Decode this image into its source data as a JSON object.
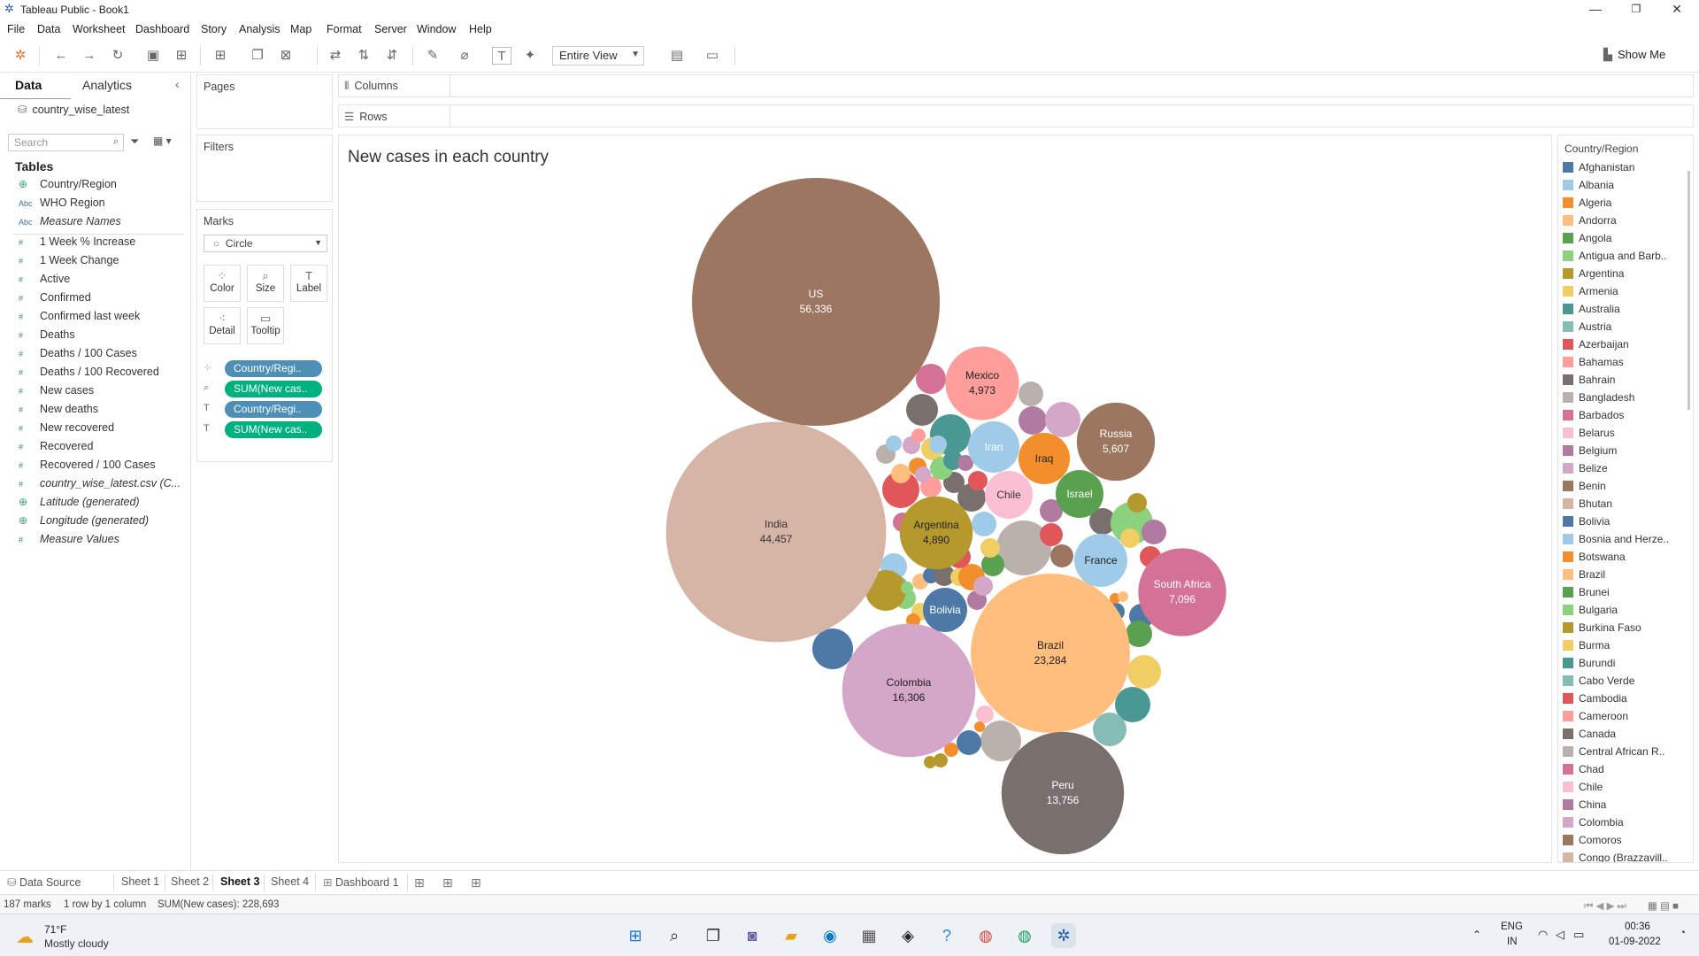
{
  "window": {
    "title": "Tableau Public - Book1",
    "minimize": "—",
    "maximize": "❐",
    "close": "✕"
  },
  "menu": [
    "File",
    "Data",
    "Worksheet",
    "Dashboard",
    "Story",
    "Analysis",
    "Map",
    "Format",
    "Server",
    "Window",
    "Help"
  ],
  "toolbar": {
    "view_mode": "Entire View",
    "show_me": "Show Me"
  },
  "data_pane": {
    "tabs": [
      "Data",
      "Analytics"
    ],
    "datasource": "country_wise_latest",
    "search_placeholder": "Search",
    "tables_header": "Tables",
    "fields": [
      {
        "type": "geo",
        "name": "Country/Region",
        "italic": false
      },
      {
        "type": "abc",
        "name": "WHO Region",
        "italic": false
      },
      {
        "type": "abc",
        "name": "Measure Names",
        "italic": true
      },
      {
        "type": "num",
        "name": "1 Week % Increase",
        "italic": false
      },
      {
        "type": "num",
        "name": "1 Week Change",
        "italic": false
      },
      {
        "type": "num",
        "name": "Active",
        "italic": false
      },
      {
        "type": "num",
        "name": "Confirmed",
        "italic": false
      },
      {
        "type": "num",
        "name": "Confirmed last week",
        "italic": false
      },
      {
        "type": "num",
        "name": "Deaths",
        "italic": false
      },
      {
        "type": "num",
        "name": "Deaths / 100 Cases",
        "italic": false
      },
      {
        "type": "num",
        "name": "Deaths / 100 Recovered",
        "italic": false
      },
      {
        "type": "num",
        "name": "New cases",
        "italic": false
      },
      {
        "type": "num",
        "name": "New deaths",
        "italic": false
      },
      {
        "type": "num",
        "name": "New recovered",
        "italic": false
      },
      {
        "type": "num",
        "name": "Recovered",
        "italic": false
      },
      {
        "type": "num",
        "name": "Recovered / 100 Cases",
        "italic": false
      },
      {
        "type": "num",
        "name": "country_wise_latest.csv (C...",
        "italic": true
      },
      {
        "type": "geo",
        "name": "Latitude (generated)",
        "italic": true
      },
      {
        "type": "geo",
        "name": "Longitude (generated)",
        "italic": true
      },
      {
        "type": "num",
        "name": "Measure Values",
        "italic": true
      }
    ]
  },
  "shelves": {
    "pages": "Pages",
    "filters": "Filters",
    "marks": "Marks",
    "marks_type": "Circle",
    "mark_buttons": [
      "Color",
      "Size",
      "Label",
      "Detail",
      "Tooltip"
    ],
    "pills": [
      {
        "kind": "dim",
        "icon": "color-icon",
        "label": "Country/Regi.."
      },
      {
        "kind": "mea",
        "icon": "size-icon",
        "label": "SUM(New cas.."
      },
      {
        "kind": "dim",
        "icon": "label-icon",
        "label": "Country/Regi.."
      },
      {
        "kind": "mea",
        "icon": "label-icon",
        "label": "SUM(New cas.."
      }
    ],
    "columns": "Columns",
    "rows": "Rows"
  },
  "viz": {
    "title": "New cases in each country"
  },
  "chart_data": {
    "type": "bubble",
    "title": "New cases in each country",
    "measure": "SUM(New cases)",
    "labeled": [
      {
        "name": "US",
        "value": 56336,
        "color": "#9c7661"
      },
      {
        "name": "India",
        "value": 44457,
        "color": "#d7b5a6"
      },
      {
        "name": "Brazil",
        "value": 23284,
        "color": "#ffbe7d"
      },
      {
        "name": "Colombia",
        "value": 16306,
        "color": "#d4a6c8"
      },
      {
        "name": "Peru",
        "value": 13756,
        "color": "#79706e"
      },
      {
        "name": "South Africa",
        "value": 7096,
        "color": "#d37295"
      },
      {
        "name": "Russia",
        "value": 5607,
        "color": "#9d7660"
      },
      {
        "name": "Mexico",
        "value": 4973,
        "color": "#ff9d9a"
      },
      {
        "name": "Argentina",
        "value": 4890,
        "color": "#b6992d"
      },
      {
        "name": "Iran",
        "value": null,
        "color": "#a0cbe8"
      },
      {
        "name": "Iraq",
        "value": null,
        "color": "#f28e2b"
      },
      {
        "name": "Chile",
        "value": null,
        "color": "#fabfd2"
      },
      {
        "name": "Israel",
        "value": null,
        "color": "#59a14f"
      },
      {
        "name": "France",
        "value": null,
        "color": "#a0cbe8"
      },
      {
        "name": "Bolivia",
        "value": null,
        "color": "#4e79a7"
      }
    ]
  },
  "legend": {
    "title": "Country/Region",
    "items": [
      {
        "name": "Afghanistan",
        "color": "#4e79a7"
      },
      {
        "name": "Albania",
        "color": "#a0cbe8"
      },
      {
        "name": "Algeria",
        "color": "#f28e2b"
      },
      {
        "name": "Andorra",
        "color": "#ffbe7d"
      },
      {
        "name": "Angola",
        "color": "#59a14f"
      },
      {
        "name": "Antigua and Barb..",
        "color": "#8cd17d"
      },
      {
        "name": "Argentina",
        "color": "#b6992d"
      },
      {
        "name": "Armenia",
        "color": "#f1ce63"
      },
      {
        "name": "Australia",
        "color": "#499894"
      },
      {
        "name": "Austria",
        "color": "#86bcb6"
      },
      {
        "name": "Azerbaijan",
        "color": "#e15759"
      },
      {
        "name": "Bahamas",
        "color": "#ff9d9a"
      },
      {
        "name": "Bahrain",
        "color": "#79706e"
      },
      {
        "name": "Bangladesh",
        "color": "#bab0ac"
      },
      {
        "name": "Barbados",
        "color": "#d37295"
      },
      {
        "name": "Belarus",
        "color": "#fabfd2"
      },
      {
        "name": "Belgium",
        "color": "#b07aa1"
      },
      {
        "name": "Belize",
        "color": "#d4a6c8"
      },
      {
        "name": "Benin",
        "color": "#9d7660"
      },
      {
        "name": "Bhutan",
        "color": "#d7b5a6"
      },
      {
        "name": "Bolivia",
        "color": "#4e79a7"
      },
      {
        "name": "Bosnia and Herze..",
        "color": "#a0cbe8"
      },
      {
        "name": "Botswana",
        "color": "#f28e2b"
      },
      {
        "name": "Brazil",
        "color": "#ffbe7d"
      },
      {
        "name": "Brunei",
        "color": "#59a14f"
      },
      {
        "name": "Bulgaria",
        "color": "#8cd17d"
      },
      {
        "name": "Burkina Faso",
        "color": "#b6992d"
      },
      {
        "name": "Burma",
        "color": "#f1ce63"
      },
      {
        "name": "Burundi",
        "color": "#499894"
      },
      {
        "name": "Cabo Verde",
        "color": "#86bcb6"
      },
      {
        "name": "Cambodia",
        "color": "#e15759"
      },
      {
        "name": "Cameroon",
        "color": "#ff9d9a"
      },
      {
        "name": "Canada",
        "color": "#79706e"
      },
      {
        "name": "Central African R..",
        "color": "#bab0ac"
      },
      {
        "name": "Chad",
        "color": "#d37295"
      },
      {
        "name": "Chile",
        "color": "#fabfd2"
      },
      {
        "name": "China",
        "color": "#b07aa1"
      },
      {
        "name": "Colombia",
        "color": "#d4a6c8"
      },
      {
        "name": "Comoros",
        "color": "#9d7660"
      },
      {
        "name": "Congo (Brazzavill..",
        "color": "#d7b5a6"
      }
    ]
  },
  "sheet_tabs": [
    "Data Source",
    "Sheet 1",
    "Sheet 2",
    "Sheet 3",
    "Sheet 4",
    "Dashboard 1"
  ],
  "active_sheet": "Sheet 3",
  "status": {
    "marks": "187 marks",
    "dims": "1 row by 1 column",
    "sum": "SUM(New cases): 228,693"
  },
  "taskbar": {
    "temp": "71°F",
    "condition": "Mostly cloudy",
    "lang1": "ENG",
    "lang2": "IN",
    "time": "00:36",
    "date": "01-09-2022"
  }
}
